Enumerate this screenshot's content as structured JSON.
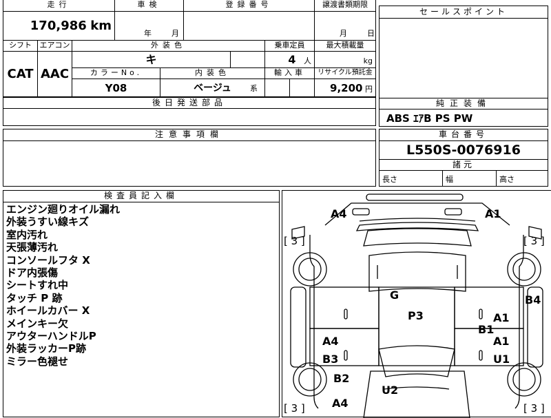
{
  "top_labels": {
    "mileage": "走行",
    "inspection": "車検",
    "registration": "登録番号",
    "transfer_date": "譲渡書類期限",
    "sales_point": "セールスポイント"
  },
  "mileage": {
    "value": "170,986",
    "unit": "km"
  },
  "inspection_units": {
    "year": "年",
    "month": "月"
  },
  "transfer_units": {
    "month": "月",
    "day": "日"
  },
  "labels2": {
    "shift": "シフト",
    "aircon": "エアコン",
    "exterior_color": "外装色",
    "capacity": "乗車定員",
    "max_load": "最大積載量",
    "color_no": "カラーNo.",
    "interior_color": "内装色",
    "import": "輸入車",
    "recycle": "リサイクル預託金"
  },
  "shift": "CAT",
  "aircon": "AAC",
  "exterior_color": "キ",
  "capacity": {
    "value": "4",
    "unit": "人"
  },
  "max_load_unit": "kg",
  "color_no": "Y08",
  "interior_color": {
    "value": "ベージュ",
    "suffix": "系"
  },
  "recycle": {
    "value": "9,200",
    "unit": "円"
  },
  "later_parts": "後日発送部品",
  "standard_equipment": {
    "label": "純正装備",
    "value": "ABS ｴｱB PS PW"
  },
  "caution": "注意事項欄",
  "chassis": {
    "label": "車台番号",
    "value": "L550S-0076916"
  },
  "dimensions": {
    "label": "諸元",
    "length": "長さ",
    "width": "幅",
    "height": "高さ"
  },
  "inspector": {
    "label": "検査員記入欄",
    "notes": [
      "エンジン廻りオイル漏れ",
      "外装うすい線キズ",
      "室内汚れ",
      "天張薄汚れ",
      "コンソールフタ X",
      "ドア内張傷",
      "シートすれ中",
      "タッチ P 跡",
      "ホイールカバー X",
      "メインキー欠",
      "アウターハンドルP",
      "外装ラッカーP跡",
      "ミラー色褪せ"
    ]
  },
  "diagram": {
    "marks": {
      "a4_top": "A4",
      "a1_top": "A1",
      "tire_tl": "[ 3 ]",
      "tire_tr": "[ 3 ]",
      "g": "G",
      "p3": "P3",
      "b4": "B4",
      "a1_right": "A1",
      "b1": "B1",
      "a1_right2": "A1",
      "u1": "U1",
      "a4_left": "A4",
      "b3": "B3",
      "b2": "B2",
      "u2": "U2",
      "a4_bottom": "A4",
      "tire_bl": "[ 3 ]",
      "tire_br": "[ 3 ]"
    }
  }
}
